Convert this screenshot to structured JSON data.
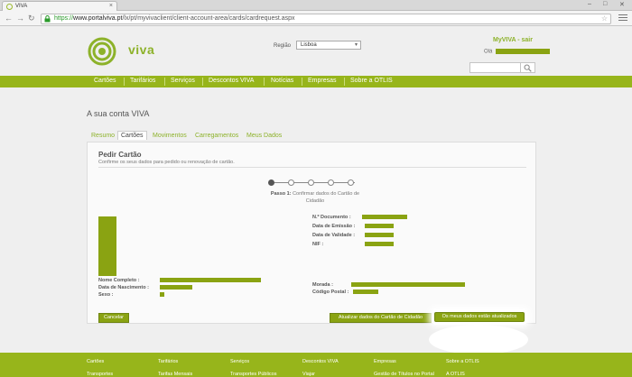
{
  "browser": {
    "tab_title": "VIVA",
    "tab_close": "×",
    "url_host": "www.portalviva.pt",
    "url_scheme": "https://",
    "url_path": "/lx/pt/myvivaclient/client-account-area/cards/cardrequest.aspx",
    "back_glyph": "←",
    "forward_glyph": "→",
    "reload_glyph": "↻",
    "star_glyph": "☆",
    "minimize": "–",
    "maximize": "□",
    "close": "✕"
  },
  "header": {
    "logo_text": "viva",
    "region_label": "Região",
    "region_value": "Lisboa",
    "myviva_label": "MyVIVA - sair",
    "greeting": "Olá"
  },
  "nav": {
    "items": [
      "Cartões",
      "Tarifários",
      "Serviços",
      "Descontos VIVA",
      "Notícias",
      "Empresas",
      "Sobre a OTLIS"
    ]
  },
  "account": {
    "title": "A sua conta VIVA",
    "tabs": [
      "Resumo",
      "Cartões",
      "Movimentos",
      "Carregamentos",
      "Meus Dados"
    ],
    "active_tab": "Cartões"
  },
  "panel": {
    "title": "Pedir Cartão",
    "subtitle": "Confirme os seus dados para pedido ou renovação de cartão.",
    "step_label": "Passo 1:",
    "step_text": "Confirmar dados do Cartão de Cidadão",
    "total_steps": 5,
    "current_step": 1,
    "fields_left": [
      "Nome Completo :",
      "Data de Nascimento :",
      "Sexo :"
    ],
    "fields_right_top": [
      "N.º Documento :",
      "Data de Emissão :",
      "Data de Validade :",
      "NIF :"
    ],
    "fields_right_bottom": [
      "Morada :",
      "Código Postal :"
    ],
    "cancel_label": "Cancelar",
    "update_label": "Atualizar dados do Cartão de Cidadão",
    "confirm_label": "Os meus dados estão atualizados"
  },
  "footer": {
    "columns": [
      {
        "title": "Cartões",
        "sub": "Transportes"
      },
      {
        "title": "Tarifários",
        "sub": "Tarifas Mensais"
      },
      {
        "title": "Serviços",
        "sub": "Transportes Públicos"
      },
      {
        "title": "Descontos VIVA",
        "sub": "Viajar"
      },
      {
        "title": "Empresas",
        "sub": "Gestão de Títulos no Portal"
      },
      {
        "title": "Sobre a OTLIS",
        "sub": "A OTLIS"
      }
    ]
  },
  "colors": {
    "brand_green": "#97b51b",
    "redaction": "#8aa312"
  }
}
